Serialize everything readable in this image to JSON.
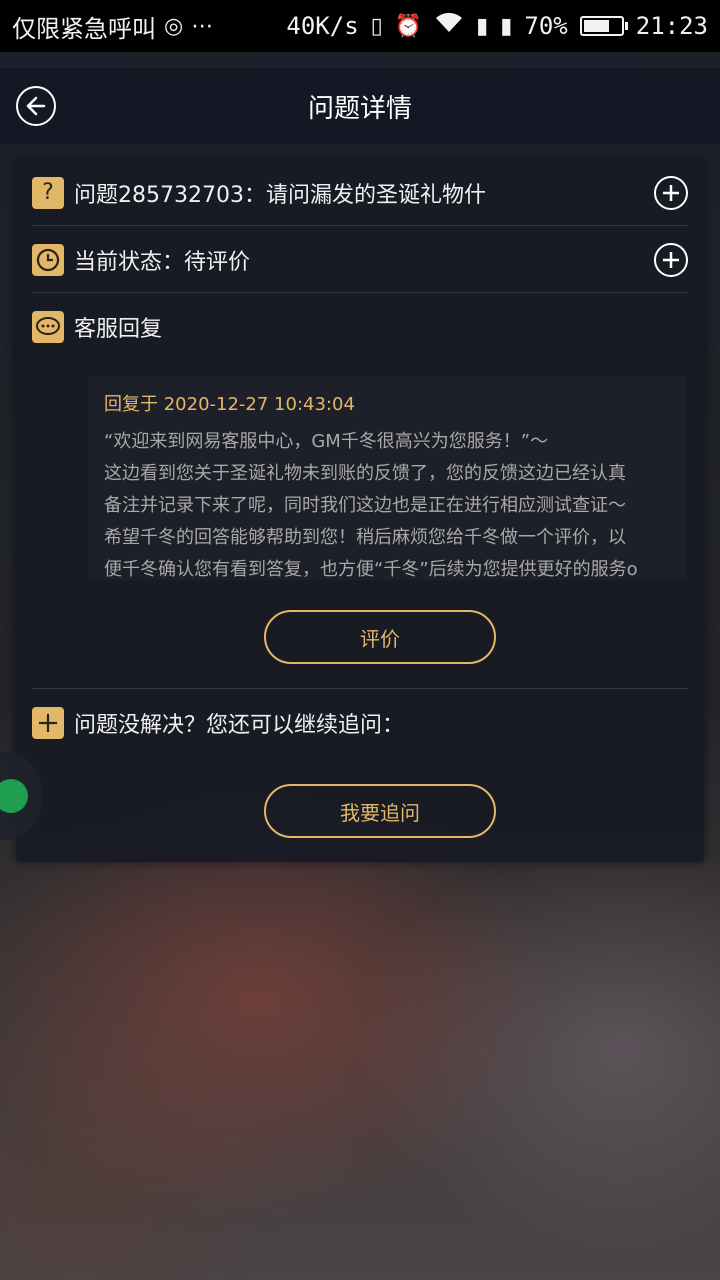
{
  "status_bar": {
    "carrier": "仅限紧急呼叫",
    "net_speed": "40K/s",
    "battery": "70%",
    "battery_level": 0.7,
    "time": "21:23",
    "icons": [
      "hotspot-icon",
      "more-icon",
      "vibrate-icon",
      "alarm-icon",
      "wifi-icon",
      "sim1-icon",
      "sim2-icon",
      "battery-icon"
    ]
  },
  "header": {
    "title": "问题详情",
    "back_icon": "back-arrow-icon"
  },
  "issue": {
    "text": "问题285732703：请问漏发的圣诞礼物什",
    "badge": "?",
    "icon": "question-icon"
  },
  "status": {
    "text": "当前状态：待评价",
    "icon": "clock-icon"
  },
  "reply_section": {
    "title": "客服回复",
    "icon": "chat-bubble-icon",
    "header": "回复于 2020-12-27 10:43:04",
    "lines": [
      "“欢迎来到网易客服中心，GM千冬很高兴为您服务！”～",
      "这边看到您关于圣诞礼物未到账的反馈了，您的反馈这边已经认真",
      "备注并记录下来了呢，同时我们这边也是正在进行相应测试查证～",
      "希望千冬的回答能够帮助到您！稍后麻烦您给千冬做一个评价，以",
      "便千冬确认您有看到答复，也方便“千冬”后续为您提供更好的服务o"
    ],
    "rate_button": "评价"
  },
  "followup": {
    "text": "问题没解决？您还可以继续追问：",
    "icon": "plus-icon",
    "button": "我要追问"
  },
  "colors": {
    "accent": "#e3b768",
    "card_bg": "#181b24",
    "nav_bg": "#141824",
    "float_dot": "#1f9e50"
  }
}
